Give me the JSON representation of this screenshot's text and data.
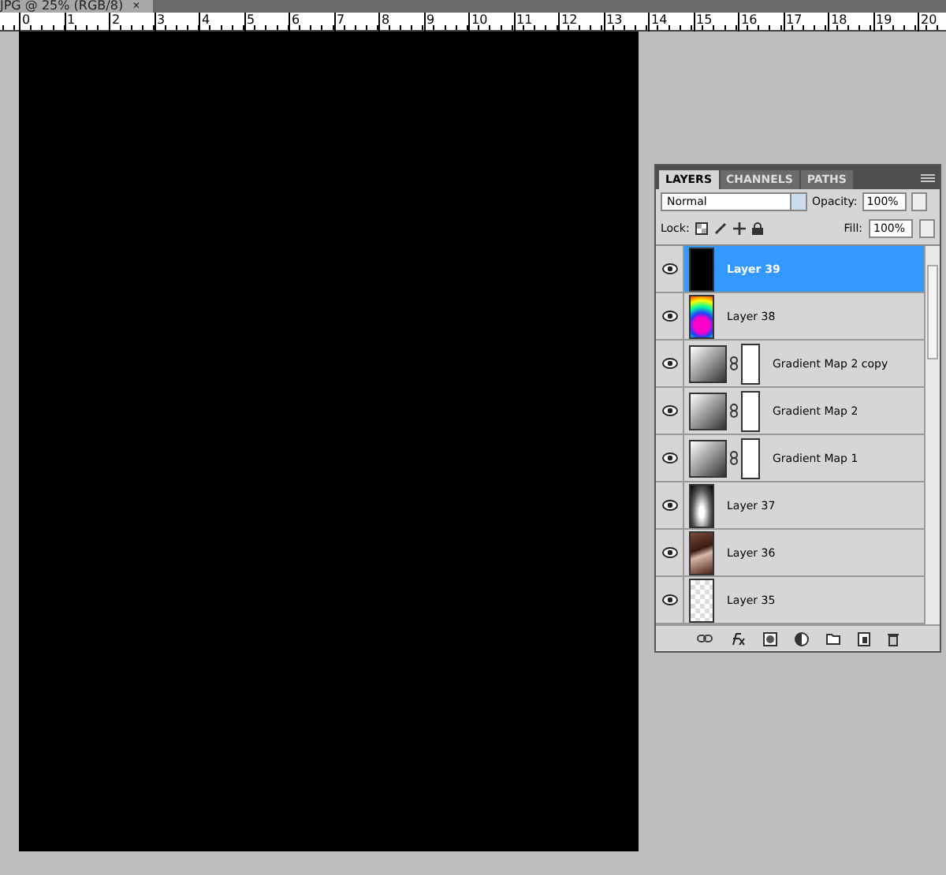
{
  "document_tab": {
    "title": "JPG @ 25% (RGB/8)",
    "close": "×"
  },
  "ruler": {
    "ticks": [
      "0",
      "1",
      "2",
      "3",
      "4",
      "5",
      "6",
      "7",
      "8",
      "9",
      "10",
      "11",
      "12",
      "13",
      "14",
      "15",
      "16",
      "17",
      "18",
      "19",
      "20"
    ]
  },
  "layers_panel": {
    "tabs": [
      {
        "label": "LAYERS",
        "selected": true
      },
      {
        "label": "CHANNELS",
        "selected": false
      },
      {
        "label": "PATHS",
        "selected": false
      }
    ],
    "blend_mode": "Normal",
    "opacity_label": "Opacity:",
    "opacity": "100%",
    "lock_label": "Lock:",
    "fill_label": "Fill:",
    "fill": "100%",
    "layers": [
      {
        "name": "Layer 39",
        "kind": "black",
        "visible": true,
        "selected": true
      },
      {
        "name": "Layer 38",
        "kind": "spectrum",
        "visible": true,
        "selected": false
      },
      {
        "name": "Gradient Map 2 copy",
        "kind": "adjustment",
        "visible": true,
        "selected": false
      },
      {
        "name": "Gradient Map 2",
        "kind": "adjustment",
        "visible": true,
        "selected": false
      },
      {
        "name": "Gradient Map 1",
        "kind": "adjustment",
        "visible": true,
        "selected": false
      },
      {
        "name": "Layer 37",
        "kind": "glow",
        "visible": true,
        "selected": false
      },
      {
        "name": "Layer 36",
        "kind": "photo",
        "visible": true,
        "selected": false
      },
      {
        "name": "Layer 35",
        "kind": "transparent",
        "visible": true,
        "selected": false
      }
    ]
  }
}
